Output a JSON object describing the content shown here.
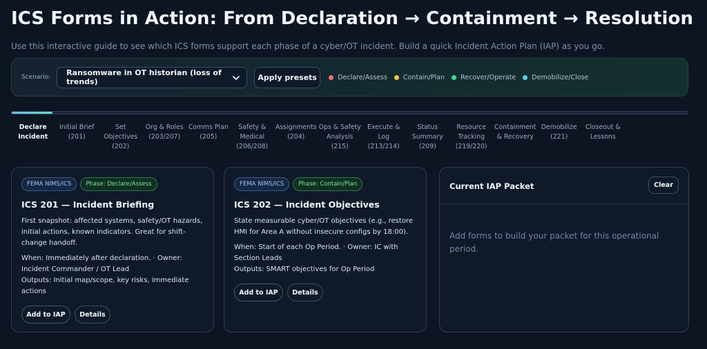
{
  "header": {
    "title": "ICS Forms in Action: From Declaration → Containment → Resolution",
    "subtitle": "Use this interactive guide to see which ICS forms support each phase of a cyber/OT incident. Build a quick Incident Action Plan (IAP) as you go."
  },
  "toolbar": {
    "scenario_label": "Scenario:",
    "scenario_value": "Ransomware in OT historian (loss of trends)",
    "apply_label": "Apply presets",
    "legend": [
      {
        "label": "Declare/Assess",
        "color": "#f07178"
      },
      {
        "label": "Contain/Plan",
        "color": "#f5c451"
      },
      {
        "label": "Recover/Operate",
        "color": "#3ddc97"
      },
      {
        "label": "Demobilize/Close",
        "color": "#4fd6e8"
      }
    ]
  },
  "progress": {
    "fraction": 0.06
  },
  "steps": [
    {
      "label": "Declare\nIncident",
      "active": true
    },
    {
      "label": "Initial Brief\n(201)",
      "active": false
    },
    {
      "label": "Set Objectives\n(202)",
      "active": false
    },
    {
      "label": "Org & Roles\n(203/207)",
      "active": false
    },
    {
      "label": "Comms Plan\n(205)",
      "active": false
    },
    {
      "label": "Safety &\nMedical\n(206/208)",
      "active": false
    },
    {
      "label": "Assignments\n(204)",
      "active": false
    },
    {
      "label": "Ops & Safety\nAnalysis (215)",
      "active": false
    },
    {
      "label": "Execute &\nLog (213/214)",
      "active": false
    },
    {
      "label": "Status\nSummary\n(209)",
      "active": false
    },
    {
      "label": "Resource\nTracking\n(219/220)",
      "active": false
    },
    {
      "label": "Containment\n& Recovery",
      "active": false
    },
    {
      "label": "Demobilize\n(221)",
      "active": false
    },
    {
      "label": "Closeout &\nLessons",
      "active": false
    }
  ],
  "cards": [
    {
      "tag_source": "FEMA NIMS/ICS",
      "tag_phase": "Phase: Declare/Assess",
      "title": "ICS 201 — Incident Briefing",
      "description": "First snapshot: affected systems, safety/OT hazards, initial actions, known indicators. Great for shift-change handoff.",
      "when": "When: Immediately after declaration. · Owner: Incident Commander / OT Lead",
      "outputs": "Outputs: Initial map/scope, key risks, immediate actions",
      "add_label": "Add to IAP",
      "details_label": "Details"
    },
    {
      "tag_source": "FEMA NIMS/ICS",
      "tag_phase": "Phase: Contain/Plan",
      "title": "ICS 202 — Incident Objectives",
      "description": "State measurable cyber/OT objectives (e.g., restore HMI for Area A without insecure configs by 18:00).",
      "when": "When: Start of each Op Period. · Owner: IC with Section Leads",
      "outputs": "Outputs: SMART objectives for Op Period",
      "add_label": "Add to IAP",
      "details_label": "Details"
    }
  ],
  "iap": {
    "title": "Current IAP Packet",
    "clear_label": "Clear",
    "empty_text": "Add forms to build your packet for this operational period."
  }
}
